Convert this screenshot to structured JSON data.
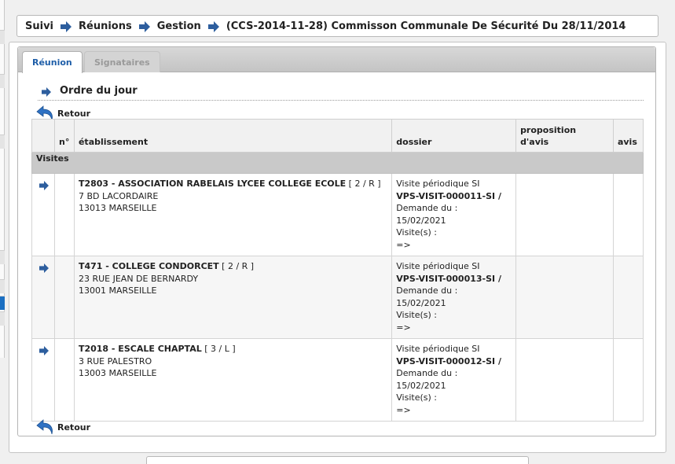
{
  "breadcrumb": {
    "items": [
      "Suivi",
      "Réunions",
      "Gestion",
      "(CCS-2014-11-28) Commisson Communale De Sécurité Du 28/11/2014"
    ]
  },
  "tabs": [
    {
      "label": "Réunion",
      "active": true
    },
    {
      "label": "Signataires",
      "active": false
    }
  ],
  "section": {
    "title": "Ordre du jour"
  },
  "back_link": {
    "label": "Retour"
  },
  "table": {
    "headers": {
      "no": "n°",
      "etablissement": "établissement",
      "dossier": "dossier",
      "proposition_line1": "proposition",
      "proposition_line2": "d'avis",
      "avis": "avis"
    },
    "group_label": "Visites",
    "rows": [
      {
        "no": "",
        "etab_name": "T2803 - ASSOCIATION RABELAIS LYCEE COLLEGE ECOLE",
        "etab_cat": " [ 2 / R ]",
        "etab_addr1": "7 BD LACORDAIRE",
        "etab_addr2": "13013 MARSEILLE",
        "dossier_type": "Visite périodique SI",
        "dossier_ref": "VPS-VISIT-000011-SI",
        "dossier_sep": " /",
        "dossier_demande": "Demande du :",
        "dossier_date": "15/02/2021",
        "dossier_visites": "Visite(s) :",
        "dossier_arrow": "=>",
        "proposition": "",
        "avis": ""
      },
      {
        "no": "",
        "etab_name": "T471 - COLLEGE CONDORCET",
        "etab_cat": " [ 2 / R ]",
        "etab_addr1": "23 RUE JEAN DE BERNARDY",
        "etab_addr2": "13001 MARSEILLE",
        "dossier_type": "Visite périodique SI",
        "dossier_ref": "VPS-VISIT-000013-SI",
        "dossier_sep": " /",
        "dossier_demande": "Demande du :",
        "dossier_date": "15/02/2021",
        "dossier_visites": "Visite(s) :",
        "dossier_arrow": "=>",
        "proposition": "",
        "avis": ""
      },
      {
        "no": "",
        "etab_name": "T2018 - ESCALE CHAPTAL",
        "etab_cat": " [ 3 / L ]",
        "etab_addr1": "3 RUE PALESTRO",
        "etab_addr2": "13003 MARSEILLE",
        "dossier_type": "Visite périodique SI",
        "dossier_ref": "VPS-VISIT-000012-SI",
        "dossier_sep": " /",
        "dossier_demande": "Demande du :",
        "dossier_date": "15/02/2021",
        "dossier_visites": "Visite(s) :",
        "dossier_arrow": "=>",
        "proposition": "",
        "avis": ""
      }
    ]
  },
  "colors": {
    "accent": "#1e5ea8",
    "arrow": "#2d5e9e",
    "group_bg": "#c9c9c9"
  },
  "icons": {
    "breadcrumb_separator": "arrow-right-icon",
    "back": "return-arrow-icon",
    "row": "arrow-right-icon"
  }
}
